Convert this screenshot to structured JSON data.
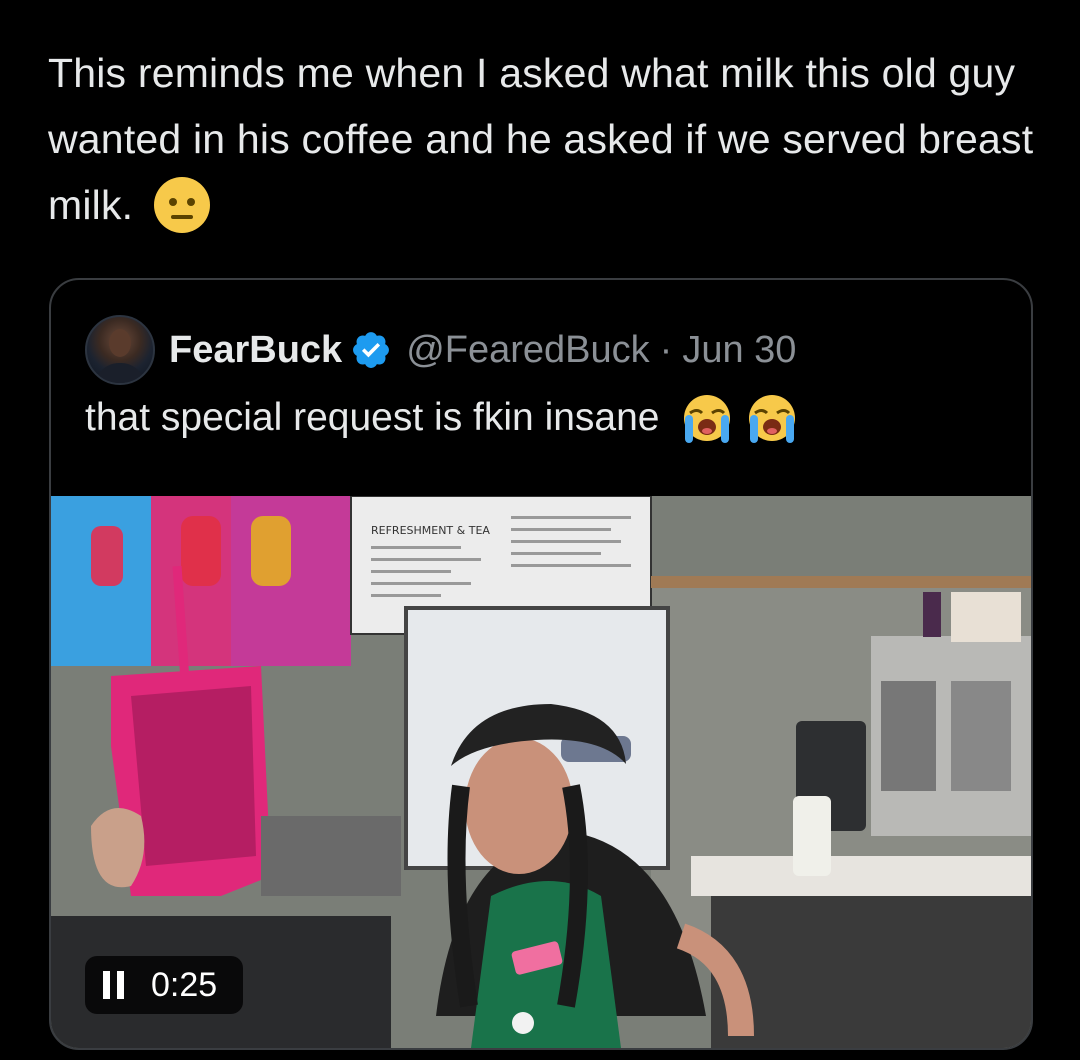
{
  "tweet": {
    "text": "This reminds me when I asked what milk this old guy wanted in his coffee and he asked if we served breast milk.",
    "emoji": "neutral-face"
  },
  "quoted_tweet": {
    "display_name": "FearBuck",
    "verified": true,
    "handle": "@FearedBuck",
    "separator": "·",
    "date": "Jun 30",
    "text": "that special request is fkin insane",
    "emojis": [
      "loudly-crying-face",
      "loudly-crying-face"
    ],
    "media": {
      "type": "video",
      "time": "0:25",
      "state": "playing",
      "menu_heading": "REFRESHMENT & TEA"
    }
  },
  "colors": {
    "background": "#000000",
    "text": "#e7e9ea",
    "secondary_text": "#8b9096",
    "verified_blue": "#1d9bf0",
    "card_border": "#3a3d41"
  }
}
